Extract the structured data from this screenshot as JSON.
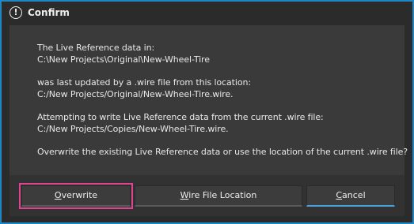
{
  "window": {
    "title": "Confirm",
    "icon": "exclamation-circle-icon",
    "icon_glyph": "!"
  },
  "message": {
    "line1": "The Live Reference data in:",
    "line2": "C:\\New Projects\\Original\\New-Wheel-Tire",
    "line3": "was last updated by a .wire file from this location:",
    "line4": "C:/New Projects/Original/New-Wheel-Tire.wire.",
    "line5": "Attempting to write Live Reference data from the current .wire file:",
    "line6": "C:/New Projects/Copies/New-Wheel-Tire.wire.",
    "line7": "Overwrite the existing Live Reference data or use the location of the current .wire file?"
  },
  "buttons": {
    "overwrite": {
      "mnemonic": "O",
      "rest": "verwrite"
    },
    "wire_location": {
      "mnemonic": "W",
      "rest": "ire File Location"
    },
    "cancel": {
      "mnemonic": "C",
      "rest": "ancel"
    }
  },
  "colors": {
    "frame_accent": "#1f88c4",
    "focus_outline": "#e0448e",
    "cancel_accent": "#4aa3df"
  }
}
